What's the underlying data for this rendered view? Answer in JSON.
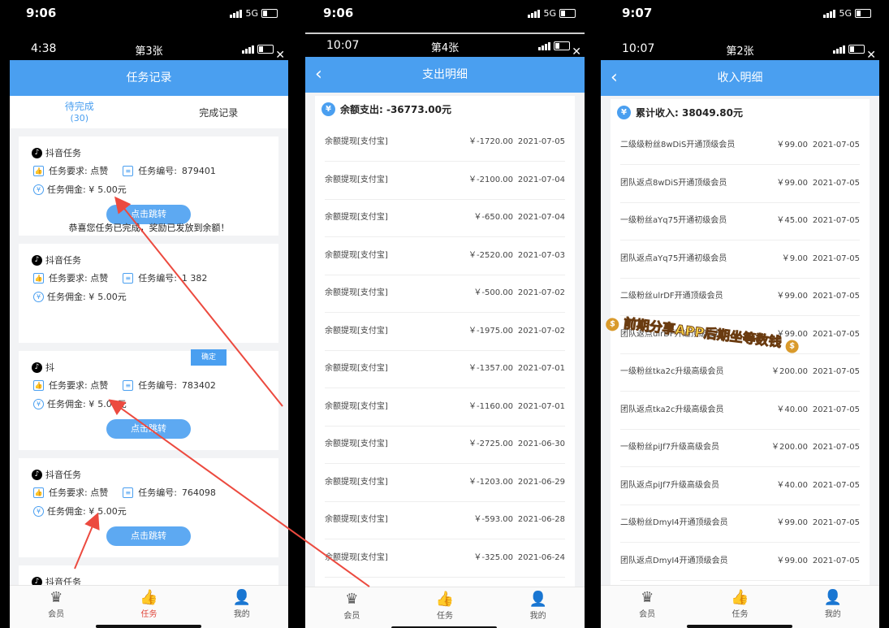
{
  "p1": {
    "outer_time": "9:06",
    "outer_net": "5G",
    "inner_time": "4:38",
    "inner_center": "第3张",
    "header_title": "任务记录",
    "tabs": {
      "pending": "待完成",
      "pending_count": "(30)",
      "done": "完成记录"
    },
    "req_label": "任务要求: 点赞",
    "no_label": "任务编号:",
    "commission_label": "任务佣金: ¥",
    "btn_label": "点击跳转",
    "cards": [
      {
        "title": "抖音任务",
        "no": "879401",
        "amount": "5.00元"
      },
      {
        "title": "抖音任务",
        "no": "1  382",
        "amount": "5.00元"
      },
      {
        "title": "抖",
        "no": "783402",
        "amount": "5.00元"
      },
      {
        "title": "抖音任务",
        "no": "764098",
        "amount": "5.00元"
      },
      {
        "title": "抖音任务"
      }
    ],
    "toast": "恭喜您任务已完成，奖励已发放到余额！",
    "ok": "确定",
    "nav": [
      "会员",
      "任务",
      "我的"
    ]
  },
  "p2": {
    "outer_time": "9:06",
    "outer_net": "5G",
    "inner_time": "10:07",
    "inner_center": "第4张",
    "header_title": "支出明细",
    "summary": "余额支出: -36773.00元",
    "rows": [
      {
        "n": "余额提现[支付宝]",
        "a": "￥-1720.00",
        "d": "2021-07-05"
      },
      {
        "n": "余额提现[支付宝]",
        "a": "￥-2100.00",
        "d": "2021-07-04"
      },
      {
        "n": "余额提现[支付宝]",
        "a": "￥-650.00",
        "d": "2021-07-04"
      },
      {
        "n": "余额提现[支付宝]",
        "a": "￥-2520.00",
        "d": "2021-07-03"
      },
      {
        "n": "余额提现[支付宝]",
        "a": "￥-500.00",
        "d": "2021-07-02"
      },
      {
        "n": "余额提现[支付宝]",
        "a": "￥-1975.00",
        "d": "2021-07-02"
      },
      {
        "n": "余额提现[支付宝]",
        "a": "￥-1357.00",
        "d": "2021-07-01"
      },
      {
        "n": "余额提现[支付宝]",
        "a": "￥-1160.00",
        "d": "2021-07-01"
      },
      {
        "n": "余额提现[支付宝]",
        "a": "￥-2725.00",
        "d": "2021-06-30"
      },
      {
        "n": "余额提现[支付宝]",
        "a": "￥-1203.00",
        "d": "2021-06-29"
      },
      {
        "n": "余额提现[支付宝]",
        "a": "￥-593.00",
        "d": "2021-06-28"
      },
      {
        "n": "余额提现[支付宝]",
        "a": "￥-325.00",
        "d": "2021-06-24"
      }
    ],
    "nav": [
      "会员",
      "任务",
      "我的"
    ]
  },
  "p3": {
    "outer_time": "9:07",
    "outer_net": "5G",
    "inner_time": "10:07",
    "inner_center": "第2张",
    "header_title": "收入明细",
    "summary": "累计收入:   38049.80元",
    "rows": [
      {
        "n": "二级级粉丝8wDiS开通顶级会员",
        "a": "￥99.00",
        "d": "2021-07-05"
      },
      {
        "n": "团队返点8wDiS开通顶级会员",
        "a": "￥99.00",
        "d": "2021-07-05"
      },
      {
        "n": "一级粉丝aYq75开通初级会员",
        "a": "￥45.00",
        "d": "2021-07-05"
      },
      {
        "n": "团队返点aYq75开通初级会员",
        "a": "￥9.00",
        "d": "2021-07-05"
      },
      {
        "n": "二级粉丝ulrDF开通顶级会员",
        "a": "￥99.00",
        "d": "2021-07-05"
      },
      {
        "n": "团队返点ulrDF开通顶级会员",
        "a": "￥99.00",
        "d": "2021-07-05"
      },
      {
        "n": "一级粉丝tka2c升级高级会员",
        "a": "￥200.00",
        "d": "2021-07-05"
      },
      {
        "n": "团队返点tka2c升级高级会员",
        "a": "￥40.00",
        "d": "2021-07-05"
      },
      {
        "n": "一级粉丝piJf7升级高级会员",
        "a": "￥200.00",
        "d": "2021-07-05"
      },
      {
        "n": "团队返点piJf7升级高级会员",
        "a": "￥40.00",
        "d": "2021-07-05"
      },
      {
        "n": "二级粉丝DmyI4开通顶级会员",
        "a": "￥99.00",
        "d": "2021-07-05"
      },
      {
        "n": "团队返点DmyI4开通顶级会员",
        "a": "￥99.00",
        "d": "2021-07-05"
      }
    ],
    "banner": "前期分享APP后期坐等数钱",
    "nav": [
      "会员",
      "任务",
      "我的"
    ]
  },
  "colors": {
    "header": "#4a9ff0",
    "arrow": "#ec4a3f",
    "nav_active": "#e0463b"
  }
}
